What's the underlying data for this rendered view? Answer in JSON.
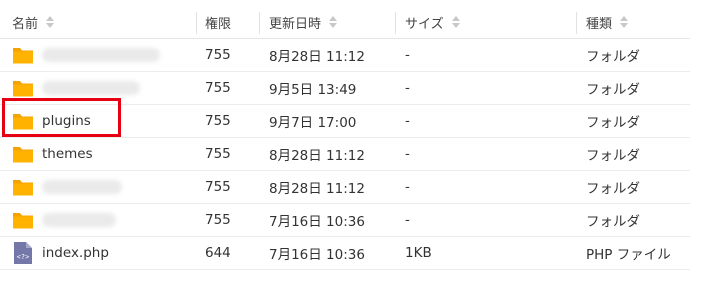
{
  "columns": {
    "name": "名前",
    "permission": "権限",
    "modified": "更新日時",
    "size": "サイズ",
    "type": "種類"
  },
  "rows": [
    {
      "name": "",
      "icon": "folder-icon",
      "permission": "755",
      "modified": "8月28日 11:12",
      "size": "-",
      "type": "フォルダ"
    },
    {
      "name": "",
      "icon": "folder-icon",
      "permission": "755",
      "modified": "9月5日 13:49",
      "size": "-",
      "type": "フォルダ"
    },
    {
      "name": "plugins",
      "icon": "folder-icon",
      "permission": "755",
      "modified": "9月7日 17:00",
      "size": "-",
      "type": "フォルダ"
    },
    {
      "name": "themes",
      "icon": "folder-icon",
      "permission": "755",
      "modified": "8月28日 11:12",
      "size": "-",
      "type": "フォルダ"
    },
    {
      "name": "",
      "icon": "folder-icon",
      "permission": "755",
      "modified": "8月28日 11:12",
      "size": "-",
      "type": "フォルダ"
    },
    {
      "name": "",
      "icon": "folder-icon",
      "permission": "755",
      "modified": "7月16日 10:36",
      "size": "-",
      "type": "フォルダ"
    },
    {
      "name": "index.php",
      "icon": "php-file-icon",
      "permission": "644",
      "modified": "7月16日 10:36",
      "size": "1KB",
      "type": "PHP ファイル"
    }
  ],
  "colors": {
    "folder": "#ffb300",
    "folder_tab": "#f5a300",
    "php_file": "#7478a8",
    "highlight": "#e60012"
  }
}
